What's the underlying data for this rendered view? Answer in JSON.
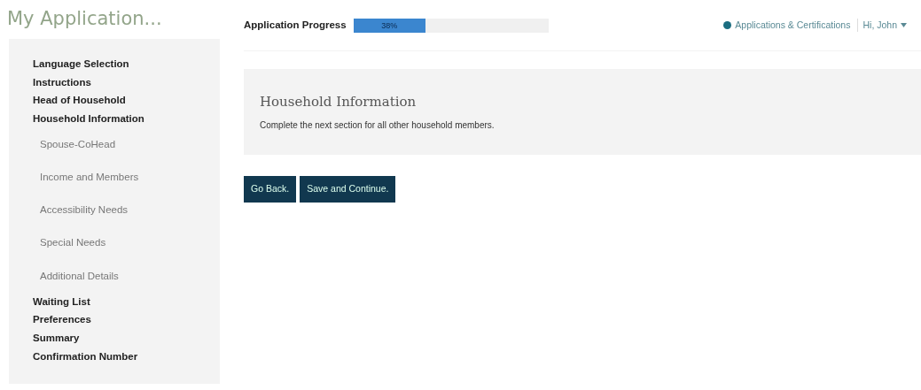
{
  "app_title": "My Application...",
  "progress": {
    "label": "Application Progress",
    "level": 0.37,
    "reading": "38%"
  },
  "nav_links": [
    {
      "label": "Applications & Certifications",
      "color": "#1b6d80"
    }
  ],
  "user_menu": {
    "label": "Hi, John"
  },
  "sidebar": {
    "items": [
      {
        "label": "Language Selection"
      },
      {
        "label": "Instructions"
      },
      {
        "label": "Head of Household"
      },
      {
        "label": "Household Information",
        "children": [
          {
            "label": "Spouse-CoHead"
          },
          {
            "label": "Income and Members"
          },
          {
            "label": "Accessibility Needs"
          },
          {
            "label": "Special Needs"
          },
          {
            "label": "Additional Details"
          }
        ]
      },
      {
        "label": "Waiting List"
      },
      {
        "label": "Preferences"
      },
      {
        "label": "Summary"
      },
      {
        "label": "Confirmation Number"
      }
    ]
  },
  "section": {
    "title": "Household Information",
    "text": "Complete the next section for all other household members."
  },
  "buttons": [
    "Go Back.",
    "Save and Continue."
  ]
}
